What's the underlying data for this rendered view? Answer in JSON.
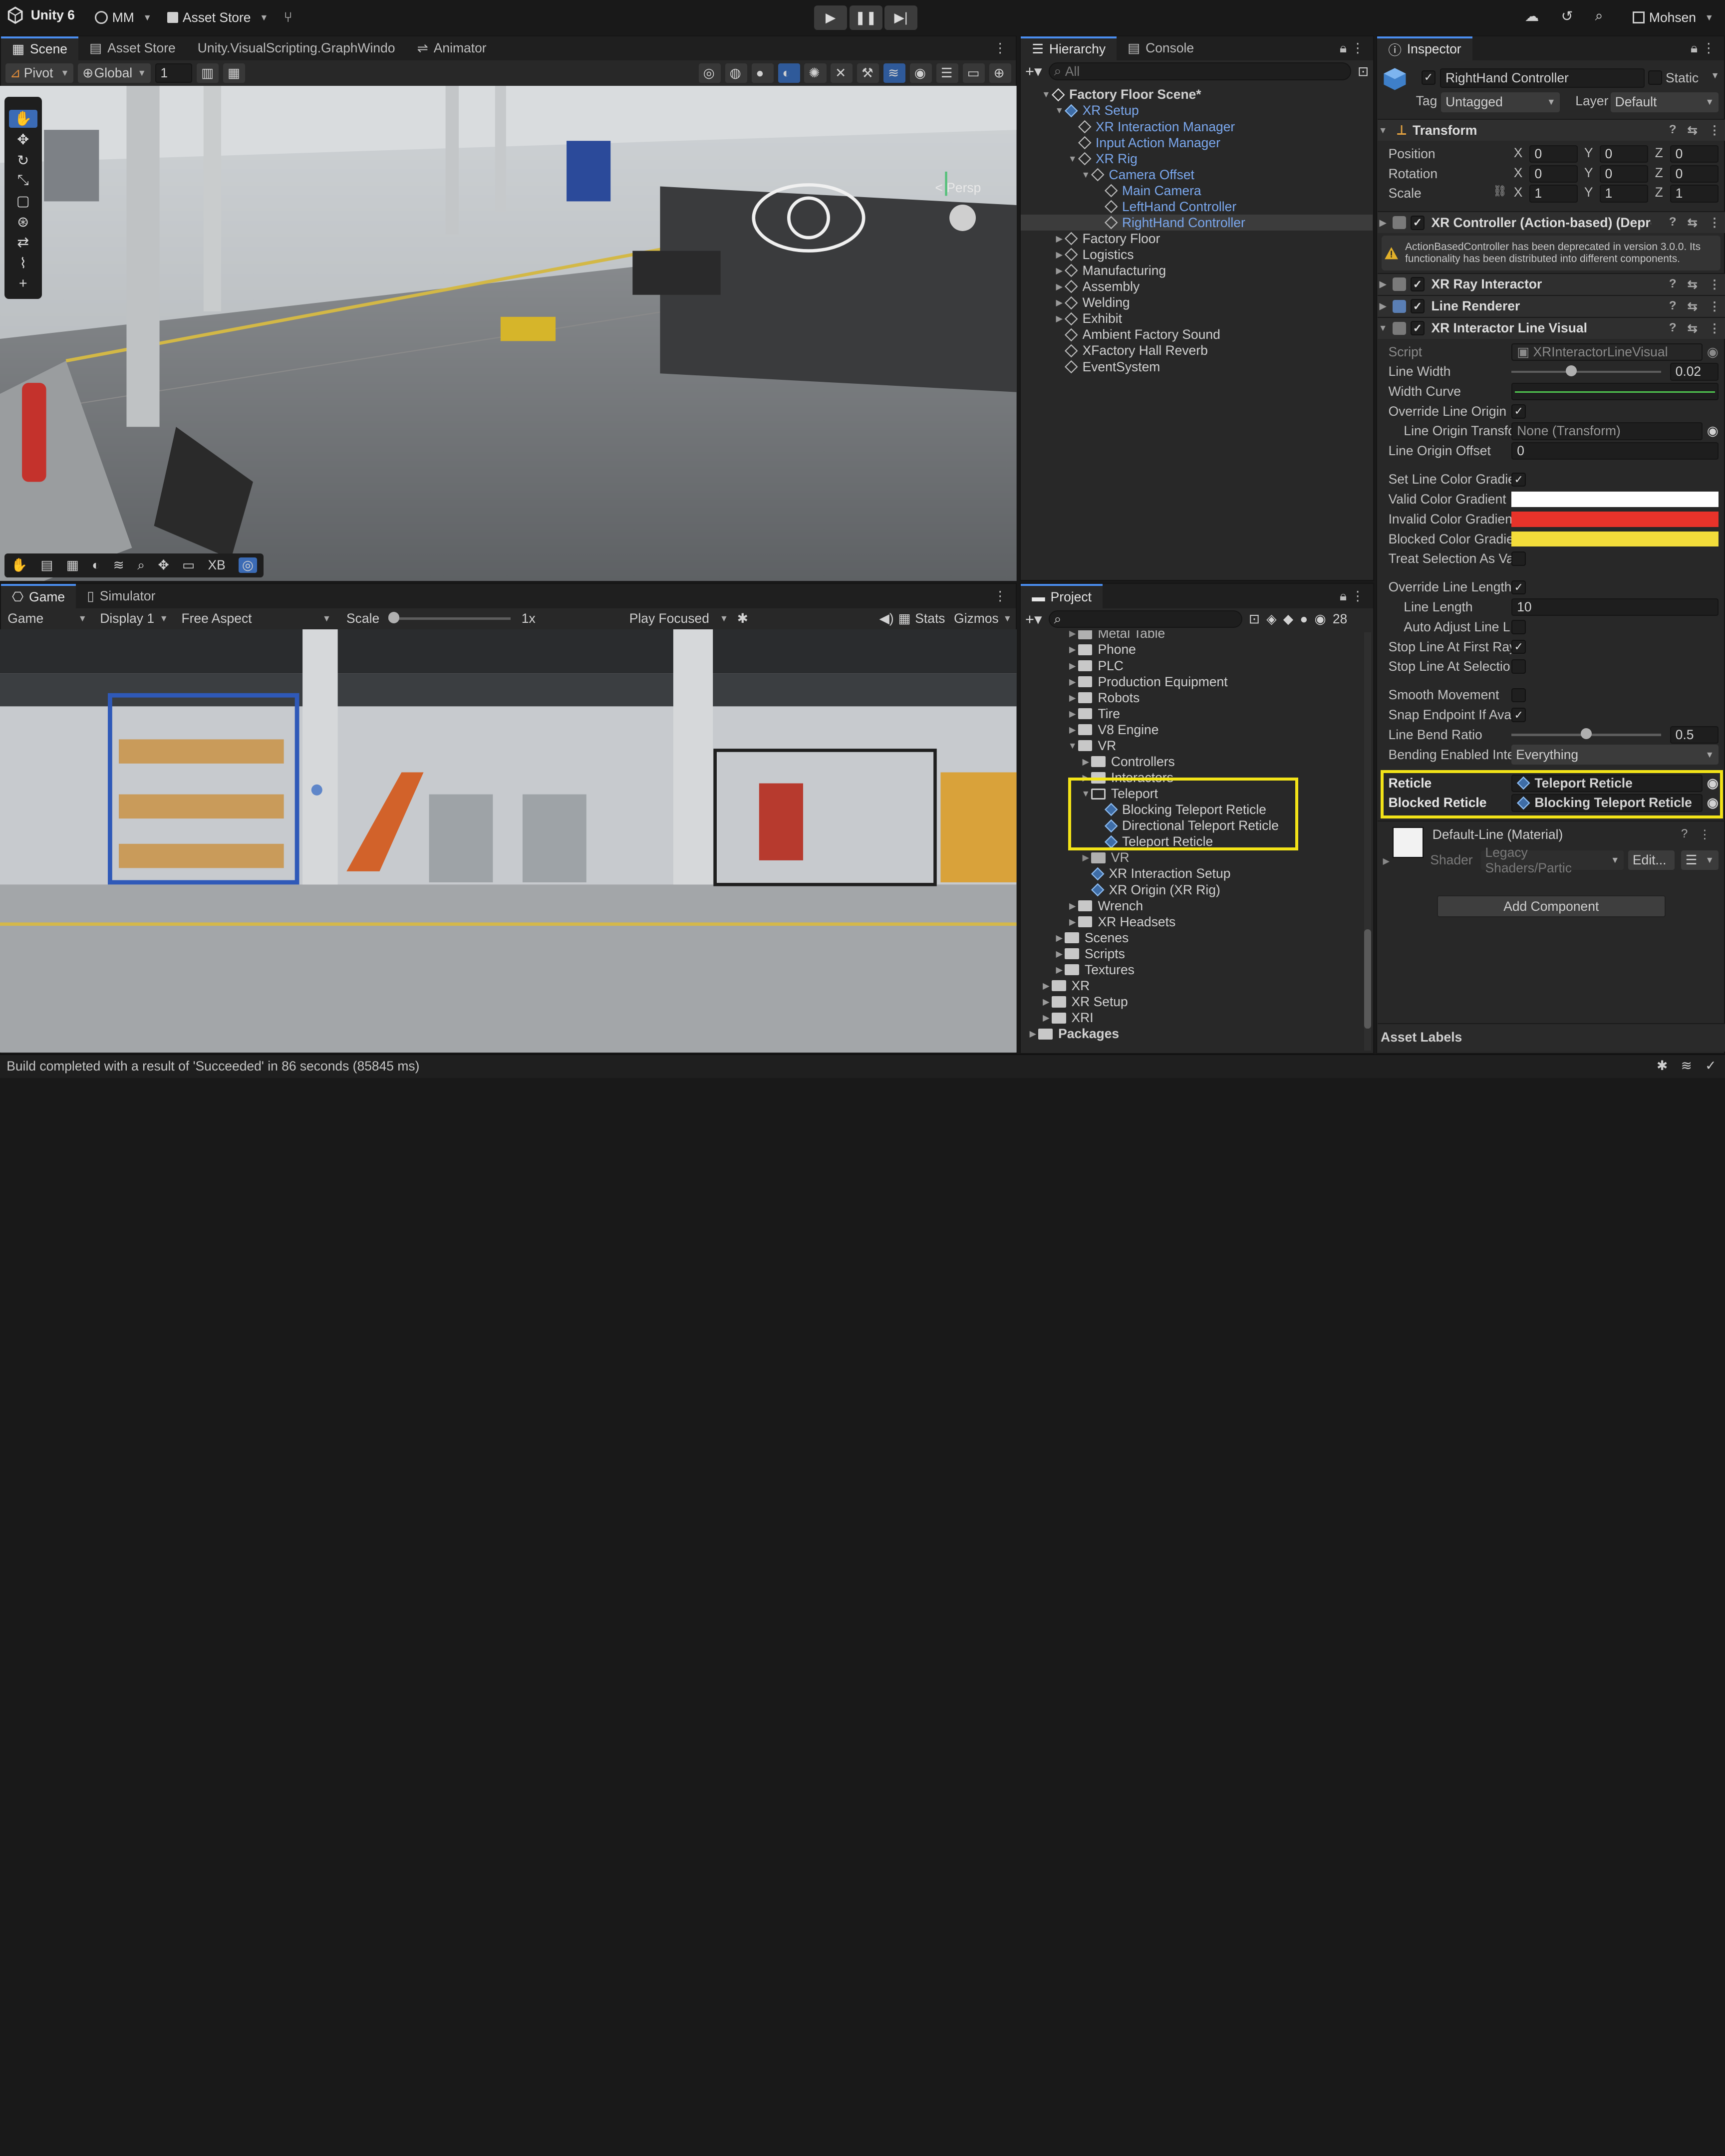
{
  "topbar": {
    "app": "Unity 6",
    "account": "MM",
    "asset_store": "Asset Store",
    "user": "Mohsen"
  },
  "scene_panel": {
    "tabs": [
      "Scene",
      "Asset Store",
      "Unity.VisualScripting.GraphWindo",
      "Animator"
    ],
    "pivot": "Pivot",
    "global": "Global",
    "grid_value": "1",
    "persp": "Persp",
    "overlay_xb": "XB"
  },
  "game_panel": {
    "tabs": [
      "Game",
      "Simulator"
    ],
    "mode": "Game",
    "display": "Display 1",
    "aspect": "Free Aspect",
    "scale_label": "Scale",
    "scale_value": "1x",
    "play_focused": "Play Focused",
    "stats": "Stats",
    "gizmos": "Gizmos"
  },
  "hierarchy": {
    "tabs": [
      "Hierarchy",
      "Console"
    ],
    "search_placeholder": "All",
    "items": [
      {
        "label": "Factory Floor Scene*",
        "depth": 0,
        "arrow": "▼",
        "type": "scene",
        "bold": true
      },
      {
        "label": "XR Setup",
        "depth": 1,
        "arrow": "▼",
        "type": "prefab",
        "blue": true
      },
      {
        "label": "XR Interaction Manager",
        "depth": 2,
        "arrow": "",
        "type": "go",
        "blue": true
      },
      {
        "label": "Input Action Manager",
        "depth": 2,
        "arrow": "",
        "type": "go",
        "blue": true
      },
      {
        "label": "XR Rig",
        "depth": 2,
        "arrow": "▼",
        "type": "go",
        "blue": true
      },
      {
        "label": "Camera Offset",
        "depth": 3,
        "arrow": "▼",
        "type": "go",
        "blue": true
      },
      {
        "label": "Main Camera",
        "depth": 4,
        "arrow": "",
        "type": "go",
        "blue": true
      },
      {
        "label": "LeftHand Controller",
        "depth": 4,
        "arrow": "",
        "type": "go",
        "blue": true
      },
      {
        "label": "RightHand Controller",
        "depth": 4,
        "arrow": "",
        "type": "go",
        "blue": true,
        "selected": true
      },
      {
        "label": "Factory Floor",
        "depth": 1,
        "arrow": "▶",
        "type": "go"
      },
      {
        "label": "Logistics",
        "depth": 1,
        "arrow": "▶",
        "type": "go"
      },
      {
        "label": "Manufacturing",
        "depth": 1,
        "arrow": "▶",
        "type": "go"
      },
      {
        "label": "Assembly",
        "depth": 1,
        "arrow": "▶",
        "type": "go"
      },
      {
        "label": "Welding",
        "depth": 1,
        "arrow": "▶",
        "type": "go"
      },
      {
        "label": "Exhibit",
        "depth": 1,
        "arrow": "▶",
        "type": "go"
      },
      {
        "label": "Ambient Factory Sound",
        "depth": 1,
        "arrow": "",
        "type": "go"
      },
      {
        "label": "XFactory Hall Reverb",
        "depth": 1,
        "arrow": "",
        "type": "go"
      },
      {
        "label": "EventSystem",
        "depth": 1,
        "arrow": "",
        "type": "go"
      }
    ]
  },
  "project": {
    "tab": "Project",
    "count": "28",
    "items": [
      {
        "label": "Metal Table",
        "depth": 2,
        "arrow": "▶",
        "type": "folder",
        "clip": true
      },
      {
        "label": "Phone",
        "depth": 2,
        "arrow": "▶",
        "type": "folder"
      },
      {
        "label": "PLC",
        "depth": 2,
        "arrow": "▶",
        "type": "folder"
      },
      {
        "label": "Production Equipment",
        "depth": 2,
        "arrow": "▶",
        "type": "folder"
      },
      {
        "label": "Robots",
        "depth": 2,
        "arrow": "▶",
        "type": "folder"
      },
      {
        "label": "Tire",
        "depth": 2,
        "arrow": "▶",
        "type": "folder"
      },
      {
        "label": "V8 Engine",
        "depth": 2,
        "arrow": "▶",
        "type": "folder"
      },
      {
        "label": "VR",
        "depth": 2,
        "arrow": "▼",
        "type": "folder"
      },
      {
        "label": "Controllers",
        "depth": 3,
        "arrow": "▶",
        "type": "folder"
      },
      {
        "label": "Interactors",
        "depth": 3,
        "arrow": "▶",
        "type": "folder"
      },
      {
        "label": "Teleport",
        "depth": 3,
        "arrow": "▼",
        "type": "folder-open"
      },
      {
        "label": "Blocking Teleport Reticle",
        "depth": 4,
        "arrow": "",
        "type": "prefab"
      },
      {
        "label": "Directional Teleport Reticle",
        "depth": 4,
        "arrow": "",
        "type": "prefab"
      },
      {
        "label": "Teleport Reticle",
        "depth": 4,
        "arrow": "",
        "type": "prefab"
      },
      {
        "label": "VR",
        "depth": 3,
        "arrow": "▶",
        "type": "folder",
        "clip": true
      },
      {
        "label": "XR Interaction Setup",
        "depth": 3,
        "arrow": "",
        "type": "prefab"
      },
      {
        "label": "XR Origin (XR Rig)",
        "depth": 3,
        "arrow": "",
        "type": "prefab"
      },
      {
        "label": "Wrench",
        "depth": 2,
        "arrow": "▶",
        "type": "folder"
      },
      {
        "label": "XR Headsets",
        "depth": 2,
        "arrow": "▶",
        "type": "folder"
      },
      {
        "label": "Scenes",
        "depth": 1,
        "arrow": "▶",
        "type": "folder"
      },
      {
        "label": "Scripts",
        "depth": 1,
        "arrow": "▶",
        "type": "folder"
      },
      {
        "label": "Textures",
        "depth": 1,
        "arrow": "▶",
        "type": "folder"
      },
      {
        "label": "XR",
        "depth": 0,
        "arrow": "▶",
        "type": "folder"
      },
      {
        "label": "XR Setup",
        "depth": 0,
        "arrow": "▶",
        "type": "folder"
      },
      {
        "label": "XRI",
        "depth": 0,
        "arrow": "▶",
        "type": "folder"
      },
      {
        "label": "Packages",
        "depth": -1,
        "arrow": "▶",
        "type": "folder",
        "bold": true
      }
    ]
  },
  "inspector": {
    "tab": "Inspector",
    "object_name": "RightHand Controller",
    "static_label": "Static",
    "tag_label": "Tag",
    "tag_value": "Untagged",
    "layer_label": "Layer",
    "layer_value": "Default",
    "transform": {
      "title": "Transform",
      "position": {
        "label": "Position",
        "x": "0",
        "y": "0",
        "z": "0"
      },
      "rotation": {
        "label": "Rotation",
        "x": "0",
        "y": "0",
        "z": "0"
      },
      "scale": {
        "label": "Scale",
        "x": "1",
        "y": "1",
        "z": "1"
      }
    },
    "xr_controller": {
      "title": "XR Controller (Action-based) (Depreca",
      "warning": "ActionBasedController has been deprecated in version 3.0.0. Its functionality has been distributed into different components."
    },
    "ray_interactor": "XR Ray Interactor",
    "line_renderer": "Line Renderer",
    "line_visual": {
      "title": "XR Interactor Line Visual",
      "script_label": "Script",
      "script_value": "XRInteractorLineVisual",
      "line_width_label": "Line Width",
      "line_width_value": "0.02",
      "line_width_fraction": 0.4,
      "width_curve_label": "Width Curve",
      "override_origin_label": "Override Line Origin",
      "origin_transform_label": "Line Origin Transfo",
      "origin_transform_value": "None (Transform)",
      "origin_offset_label": "Line Origin Offset",
      "origin_offset_value": "0",
      "set_color_label": "Set Line Color Gradie",
      "valid_color_label": "Valid Color Gradient",
      "invalid_color_label": "Invalid Color Gradien",
      "blocked_color_label": "Blocked Color Gradie",
      "treat_selection_label": "Treat Selection As Va",
      "override_length_label": "Override Line Length",
      "line_length_label": "Line Length",
      "line_length_value": "10",
      "auto_adjust_label": "Auto Adjust Line L",
      "stop_first_label": "Stop Line At First Ray",
      "stop_selection_label": "Stop Line At Selectio",
      "smooth_label": "Smooth Movement",
      "snap_label": "Snap Endpoint If Avai",
      "bend_ratio_label": "Line Bend Ratio",
      "bend_ratio_value": "0.5",
      "bend_ratio_fraction": 0.5,
      "bending_label": "Bending Enabled Inte",
      "bending_value": "Everything",
      "reticle_label": "Reticle",
      "reticle_value": "Teleport Reticle",
      "blocked_reticle_label": "Blocked Reticle",
      "blocked_reticle_value": "Blocking Teleport Reticle"
    },
    "material": {
      "name": "Default-Line (Material)",
      "shader_label": "Shader",
      "shader_value": "Legacy Shaders/Partic",
      "edit_label": "Edit..."
    },
    "add_component": "Add Component",
    "asset_labels": "Asset Labels"
  },
  "colors": {
    "valid_gradient": "#ffffff",
    "invalid_gradient": "#e8332a",
    "blocked_gradient": "#f2dc3a",
    "highlight": "#f2e318",
    "accent": "#4b8ef0"
  },
  "status": {
    "message": "Build completed with a result of 'Succeeded' in 86 seconds (85845 ms)"
  }
}
